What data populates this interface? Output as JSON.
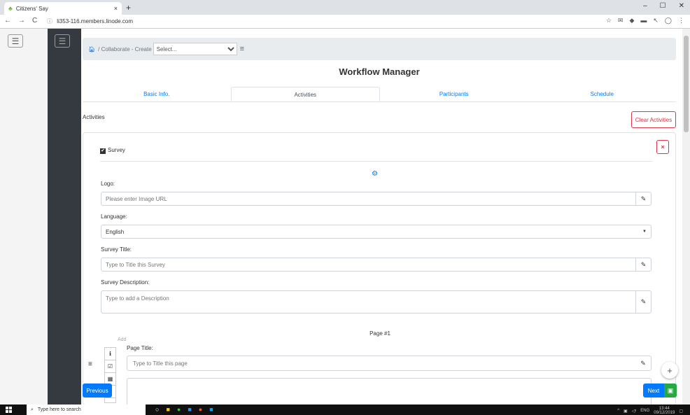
{
  "browser": {
    "tab_title": "Citizens' Say",
    "tab_close": "×",
    "new_tab": "+",
    "url": "li353-116.members.linode.com",
    "win_minimize": "–",
    "win_maximize": "☐",
    "win_close": "✕"
  },
  "breadcrumb": {
    "path": "/ Collaborate - Create",
    "select_value": "Select..."
  },
  "title": "Workflow Manager",
  "tabs": [
    "Basic Info.",
    "Activities",
    "Participants",
    "Schedule"
  ],
  "activities_label": "Activities",
  "clear_button": "Clear Activities",
  "survey": {
    "checkbox_label": "Survey",
    "logo_label": "Logo:",
    "logo_placeholder": "Please enter Image URL",
    "language_label": "Language:",
    "language_value": "English",
    "title_label": "Survey Title:",
    "title_placeholder": "Type to Title this Survey",
    "desc_label": "Survey Description:",
    "desc_placeholder": "Type to add a Description"
  },
  "page": {
    "heading": "Page #1",
    "add_label": "Add",
    "title_label": "Page Title:",
    "title_placeholder": "Type to Title this page"
  },
  "buttons": {
    "previous": "Previous",
    "next": "Next"
  },
  "taskbar": {
    "search": "Type here to search",
    "lang": "ENG",
    "time": "13:44",
    "date": "09/12/2019"
  }
}
